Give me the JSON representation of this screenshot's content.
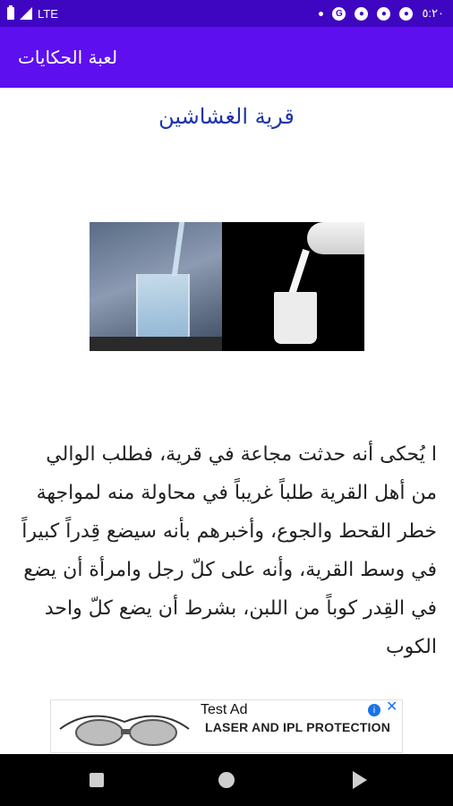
{
  "status_bar": {
    "network": "LTE",
    "time": "٥:٢٠"
  },
  "app_bar": {
    "title": "لعبة الحكايات"
  },
  "story": {
    "title": "قرية الغشاشين",
    "body": "ا يُحكى أنه حدثت مجاعة في قرية، فطلب الوالي من أهل القرية طلباً غريباً في محاولة منه لمواجهة خطر القحط والجوع، وأخبرهم بأنه سيضع قِدراً كبيراً في وسط القرية، وأنه على كلّ رجل وامرأة أن يضع في القِدر كوباً من اللبن، بشرط أن يضع كلّ واحد الكوب"
  },
  "ad": {
    "label": "Test Ad",
    "headline": "LASER AND IPL PROTECTION",
    "info": "i",
    "close": "✕"
  },
  "colors": {
    "status_bar": "#3f06c2",
    "app_bar": "#5d0ff0",
    "title_text": "#2034a8"
  }
}
